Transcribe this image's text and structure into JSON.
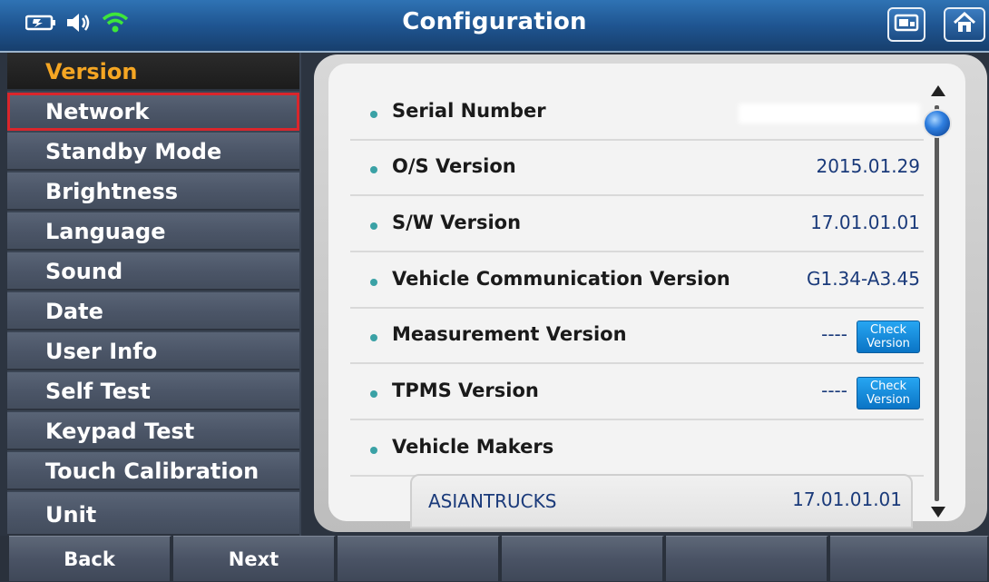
{
  "header": {
    "title": "Configuration",
    "status_icons": [
      "battery-charging-icon",
      "speaker-volume-icon",
      "wifi-icon"
    ],
    "right_buttons": [
      "screen-capture-icon",
      "home-icon"
    ]
  },
  "sidebar": {
    "items": [
      {
        "label": "Version",
        "active": true
      },
      {
        "label": "Network",
        "highlighted": true
      },
      {
        "label": "Standby Mode"
      },
      {
        "label": "Brightness"
      },
      {
        "label": "Language"
      },
      {
        "label": "Sound"
      },
      {
        "label": "Date"
      },
      {
        "label": "User Info"
      },
      {
        "label": "Self Test"
      },
      {
        "label": "Keypad Test"
      },
      {
        "label": "Touch Calibration"
      },
      {
        "label": "Unit"
      }
    ]
  },
  "content": {
    "rows": [
      {
        "label": "Serial Number",
        "value": ""
      },
      {
        "label": "O/S Version",
        "value": "2015.01.29"
      },
      {
        "label": "S/W Version",
        "value": "17.01.01.01"
      },
      {
        "label": "Vehicle Communication Version",
        "value": "G1.34-A3.45"
      },
      {
        "label": "Measurement Version",
        "value": "----",
        "button_line1": "Check",
        "button_line2": "Version"
      },
      {
        "label": "TPMS Version",
        "value": "----",
        "button_line1": "Check",
        "button_line2": "Version"
      },
      {
        "label": "Vehicle Makers",
        "value": ""
      }
    ],
    "makers": [
      {
        "name": "ASIANTRUCKS",
        "version": "17.01.01.01"
      }
    ]
  },
  "footer": {
    "buttons": [
      "Back",
      "Next",
      "",
      "",
      "",
      ""
    ]
  },
  "colors": {
    "accent": "#f5a623",
    "highlight_box": "#d9262c",
    "title_bar": "#1f5591",
    "value_text": "#1a3a7a"
  }
}
